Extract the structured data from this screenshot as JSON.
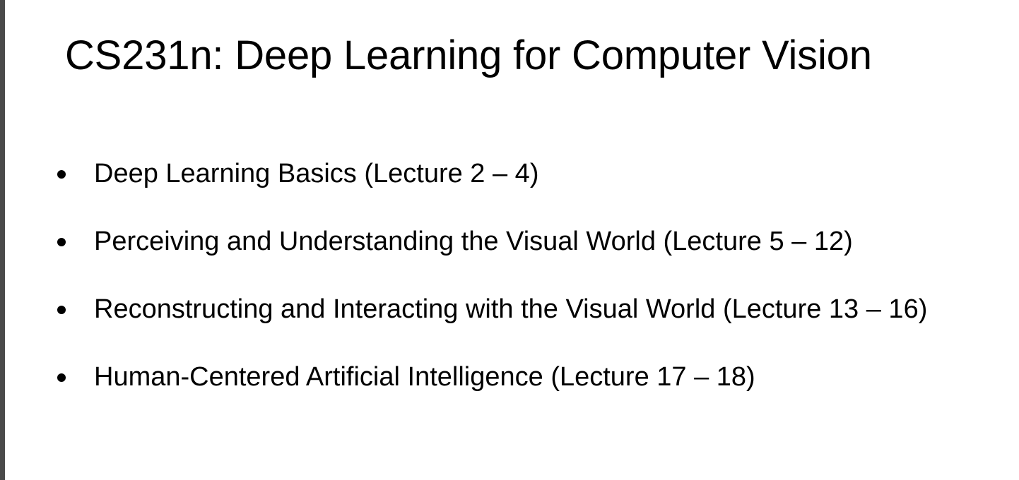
{
  "slide": {
    "title": "CS231n: Deep Learning for Computer Vision",
    "bullets": [
      "Deep Learning Basics (Lecture 2 – 4)",
      "Perceiving and Understanding the Visual World (Lecture 5 – 12)",
      "Reconstructing and Interacting with the Visual World (Lecture 13 – 16)",
      "Human-Centered Artificial Intelligence (Lecture 17 – 18)"
    ]
  },
  "colors": {
    "background": "#ffffff",
    "text": "#000000",
    "viewer_edge": "#4a4a4a"
  }
}
